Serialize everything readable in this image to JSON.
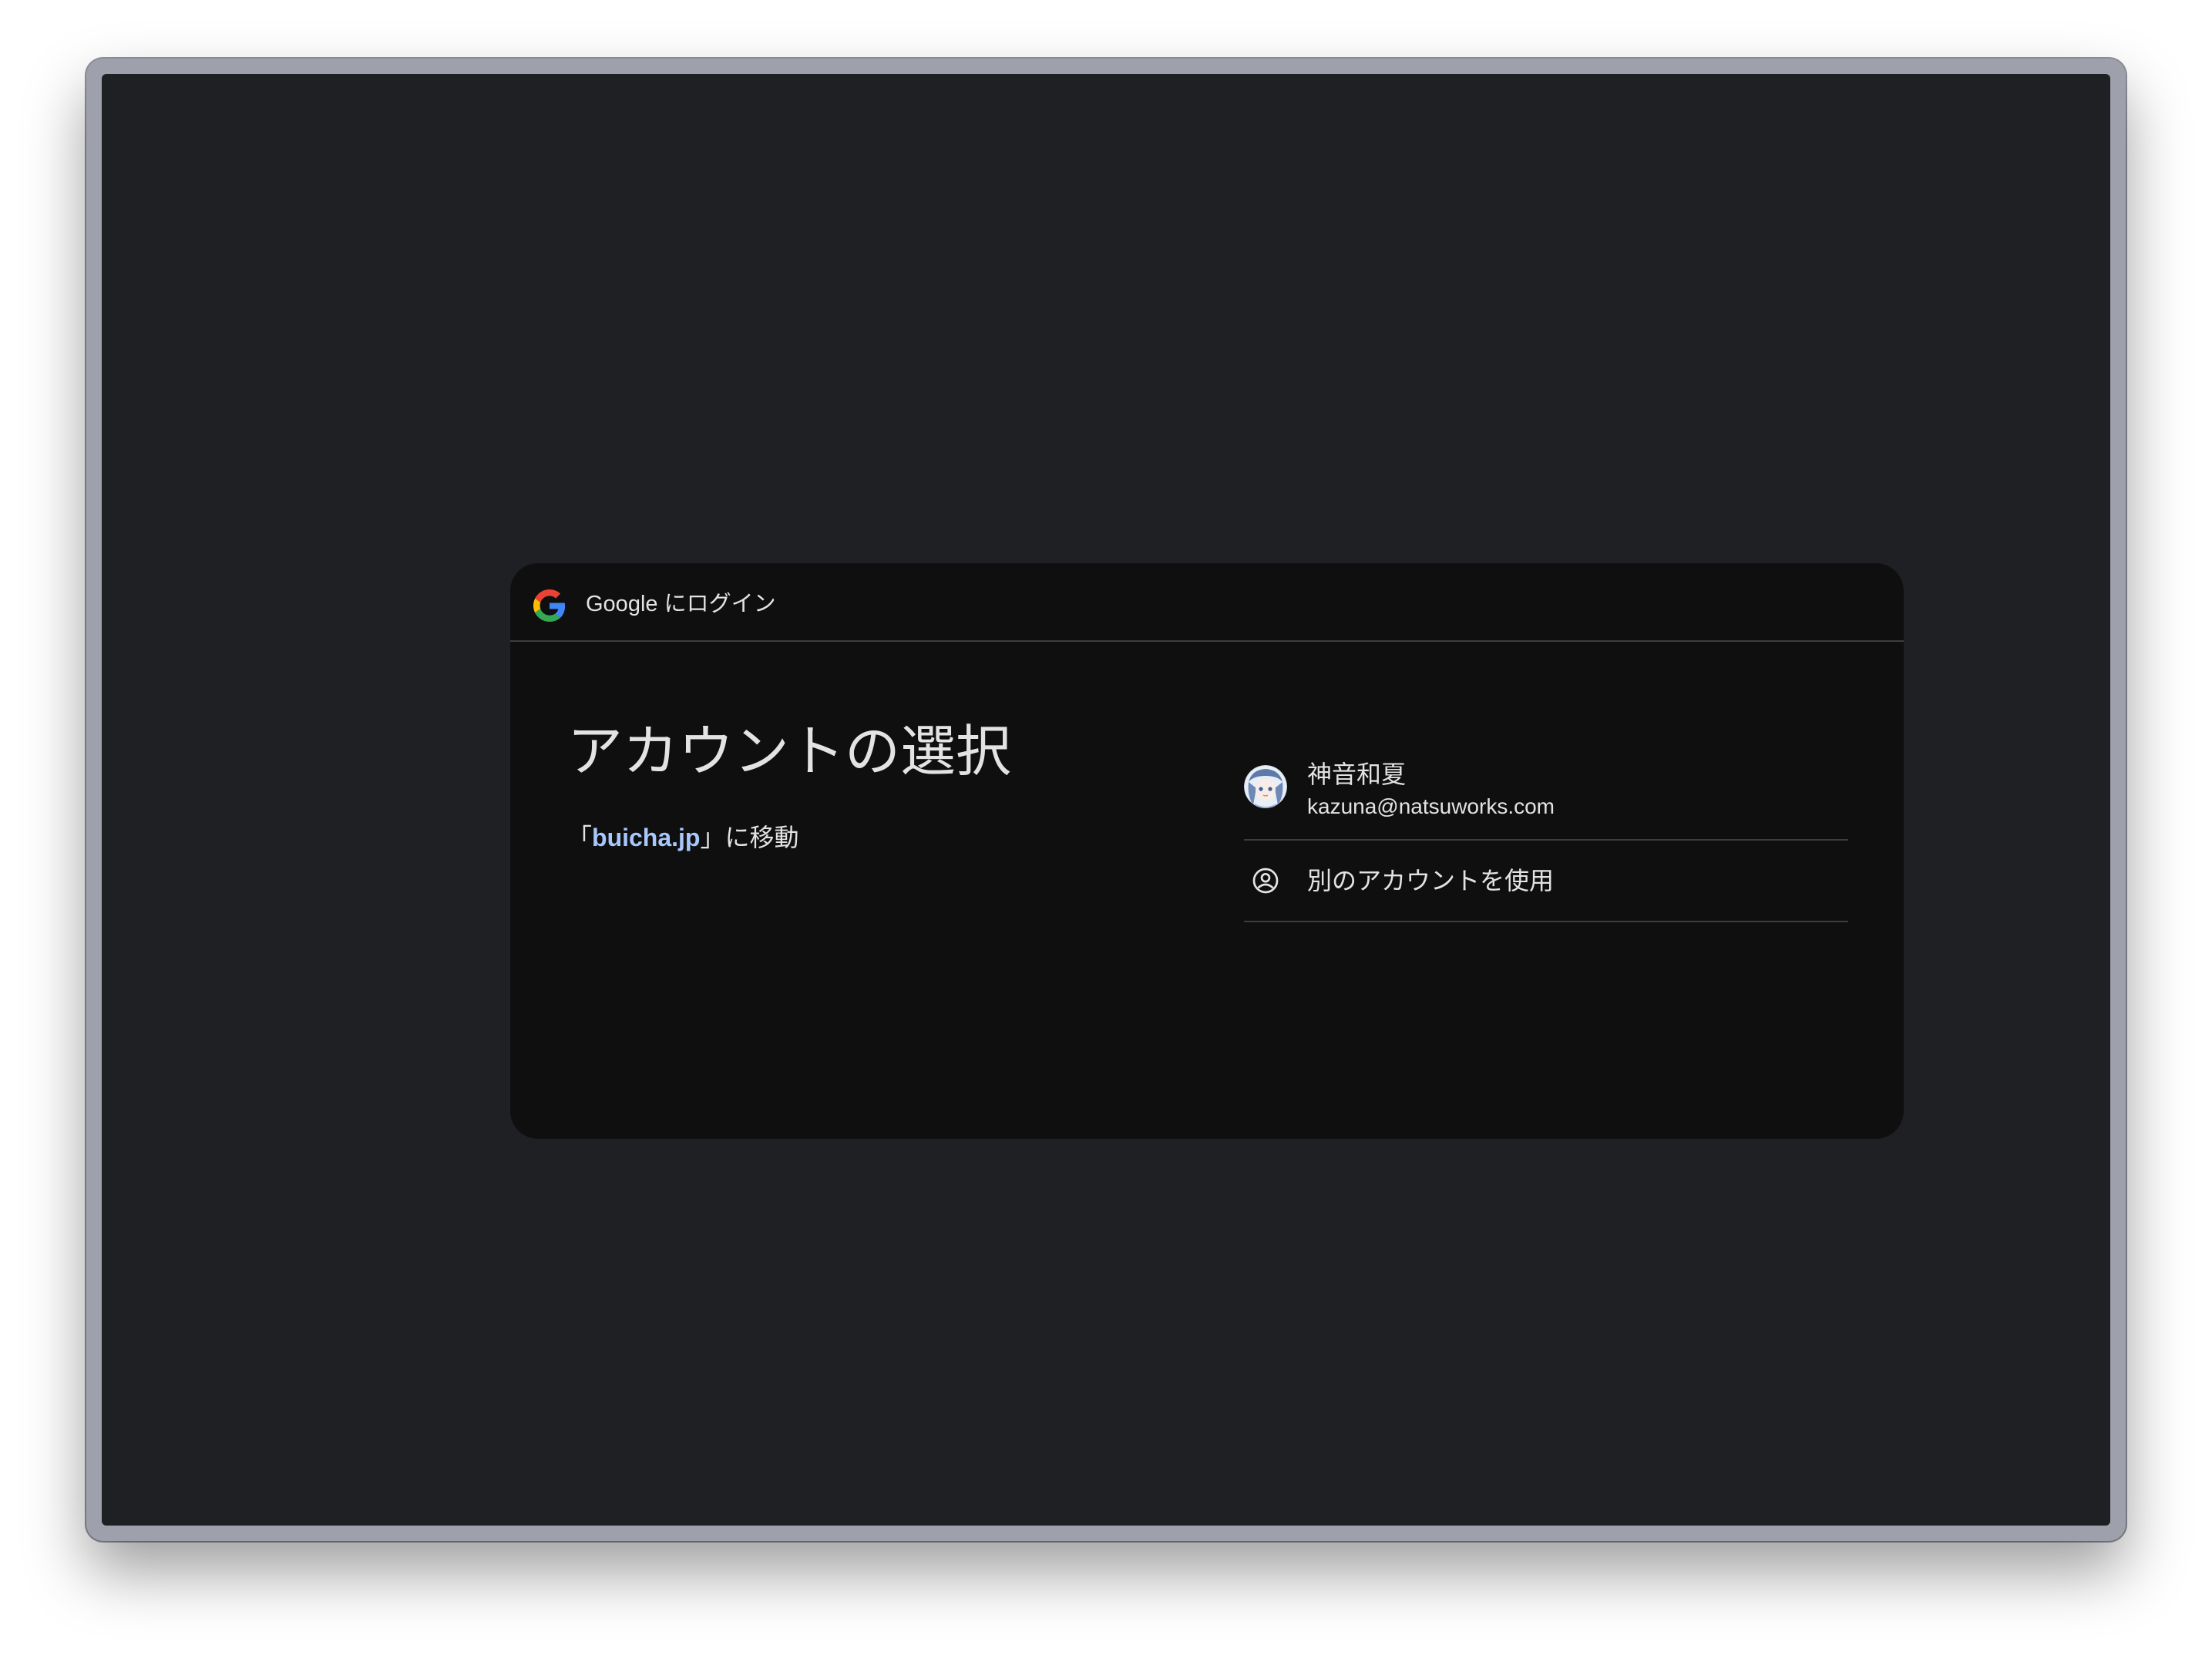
{
  "header": {
    "title": "Google にログイン",
    "logo_icon": "google-g-icon"
  },
  "main": {
    "title": "アカウントの選択",
    "subtitle_prefix": "「",
    "subtitle_link": "buicha.jp",
    "subtitle_suffix": "」に移動"
  },
  "accounts": [
    {
      "name": "神音和夏",
      "email": "kazuna@natsuworks.com",
      "avatar_icon": "avatar"
    }
  ],
  "other_account": {
    "label": "別のアカウントを使用",
    "icon": "person-circle-icon"
  },
  "colors": {
    "window_bg": "#1f2023",
    "dialog_bg": "#0f0f10",
    "text": "#e3e3e3",
    "link": "#a8c7fa",
    "divider": "#3c3d40",
    "frame": "#9ea1ab"
  }
}
